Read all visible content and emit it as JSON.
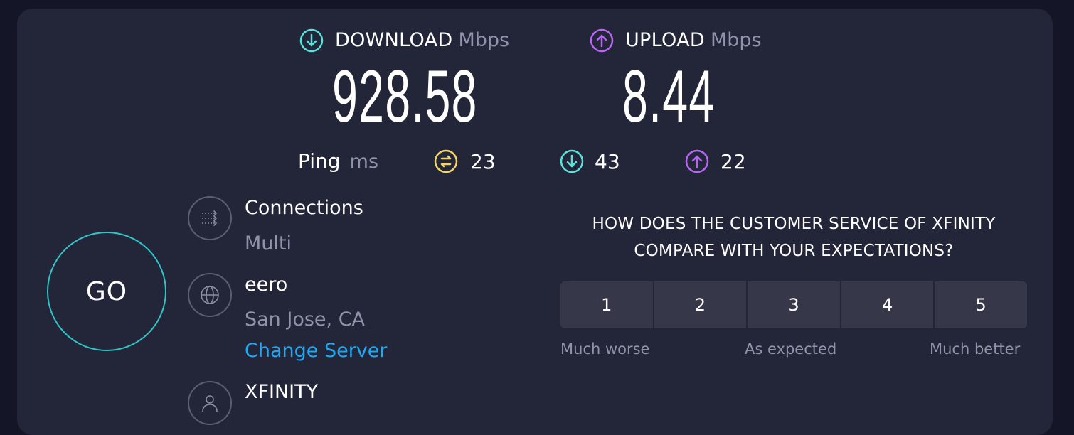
{
  "download": {
    "label": "DOWNLOAD",
    "unit": "Mbps",
    "value": "928.58",
    "icon": "arrow-down-circle-icon",
    "color": "#57e3d9"
  },
  "upload": {
    "label": "UPLOAD",
    "unit": "Mbps",
    "value": "8.44",
    "icon": "arrow-up-circle-icon",
    "color": "#b866f5"
  },
  "ping": {
    "label": "Ping",
    "unit": "ms",
    "idle": {
      "value": "23",
      "icon": "ping-idle-icon",
      "color": "#f1d662"
    },
    "download": {
      "value": "43",
      "icon": "arrow-down-circle-icon"
    },
    "upload": {
      "value": "22",
      "icon": "arrow-up-circle-icon"
    }
  },
  "go_label": "GO",
  "connections": {
    "title": "Connections",
    "value": "Multi",
    "icon": "connections-icon"
  },
  "server": {
    "title": "eero",
    "location": "San Jose, CA",
    "change_label": "Change Server",
    "icon": "globe-icon"
  },
  "provider": {
    "title": "XFINITY",
    "icon": "user-icon"
  },
  "survey": {
    "question_line1": "HOW DOES THE CUSTOMER SERVICE OF XFINITY",
    "question_line2": "COMPARE WITH YOUR EXPECTATIONS?",
    "options": [
      "1",
      "2",
      "3",
      "4",
      "5"
    ],
    "scale_low": "Much worse",
    "scale_mid": "As expected",
    "scale_high": "Much better"
  }
}
